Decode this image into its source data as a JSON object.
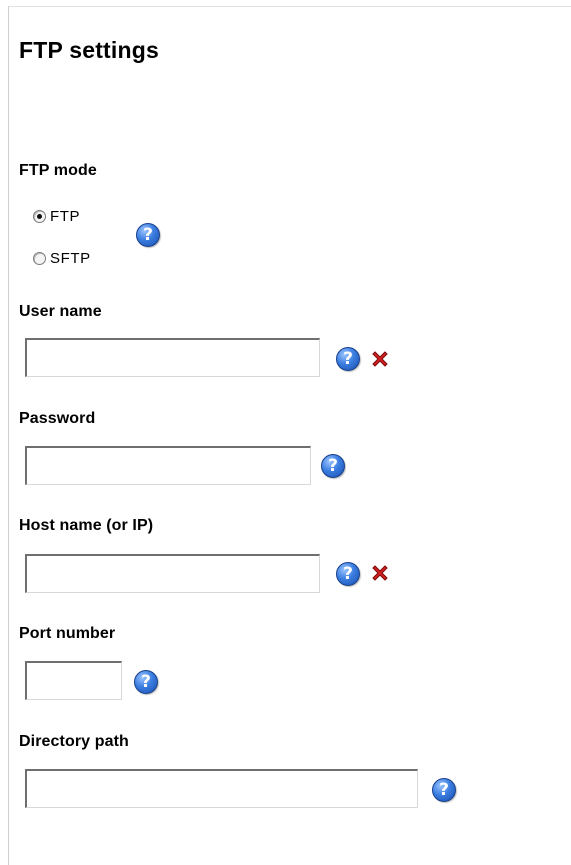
{
  "title": "FTP settings",
  "ftp_mode": {
    "label": "FTP mode",
    "options": [
      {
        "label": "FTP",
        "selected": true
      },
      {
        "label": "SFTP",
        "selected": false
      }
    ]
  },
  "fields": {
    "user_name": {
      "label": "User name",
      "value": ""
    },
    "password": {
      "label": "Password",
      "value": ""
    },
    "host_name": {
      "label": "Host name (or IP)",
      "value": ""
    },
    "port_number": {
      "label": "Port number",
      "value": ""
    },
    "directory_path": {
      "label": "Directory path",
      "value": ""
    }
  },
  "icons": {
    "help": "help-icon",
    "clear": "clear-icon",
    "help_glyph": "?"
  },
  "colors": {
    "help_blue": "#2f6fd6",
    "clear_red": "#d42020"
  }
}
